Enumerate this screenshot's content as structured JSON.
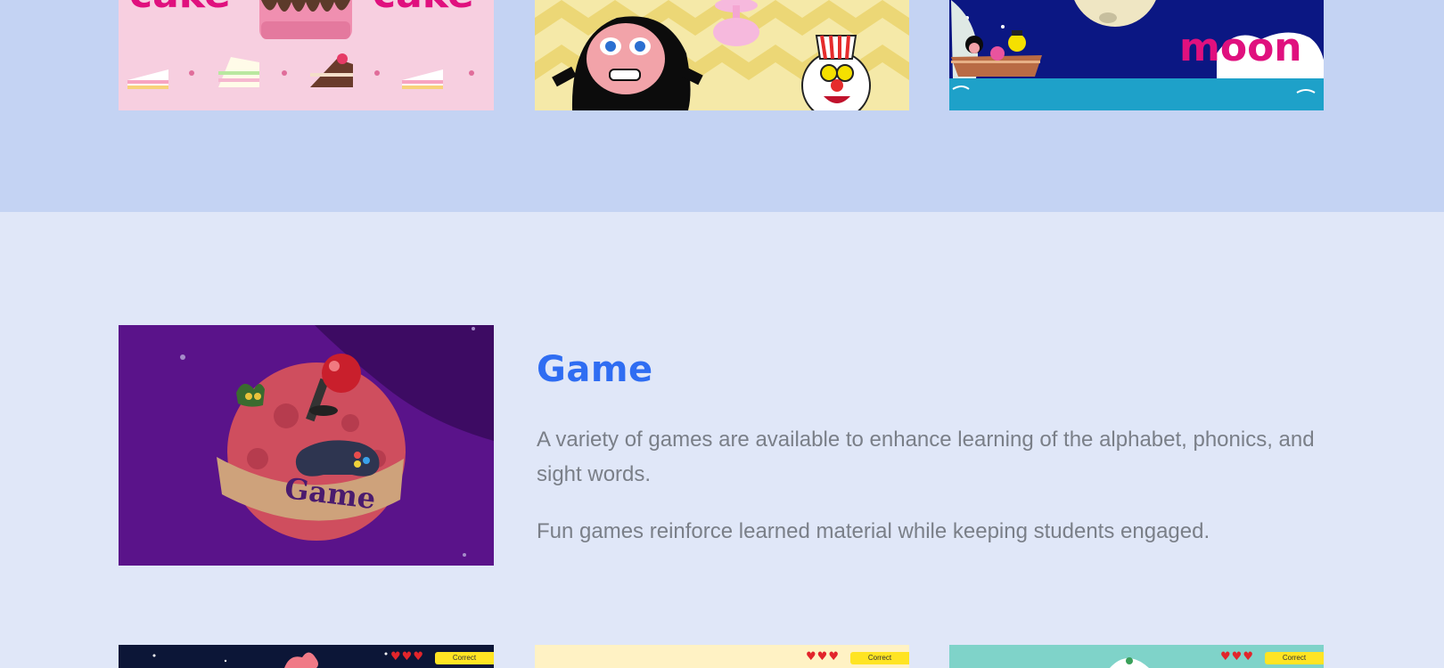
{
  "thumbnails_top": [
    {
      "id": "cake",
      "word_left": "cake",
      "word_right": "cake"
    },
    {
      "id": "hood"
    },
    {
      "id": "moon",
      "word": "moon"
    }
  ],
  "game_section": {
    "title": "Game",
    "desc1": "A variety of games are available to enhance learning of the alphabet, phonics, and sight words.",
    "desc2": "Fun games reinforce learned material while keeping students engaged.",
    "image_label": "Game"
  },
  "thumbnails_bottom": [
    {
      "id": "space",
      "hearts": "♥♥♥",
      "status": "Correct"
    },
    {
      "id": "yellow",
      "hearts": "♥♥♥",
      "status": "Correct"
    },
    {
      "id": "teal",
      "hearts": "♥♥♥",
      "status": "Correct"
    }
  ],
  "colors": {
    "top_band": "#c4d3f3",
    "section_bg": "#e0e7f8",
    "title_blue": "#2f6df2",
    "text_gray": "#7a7f88"
  }
}
